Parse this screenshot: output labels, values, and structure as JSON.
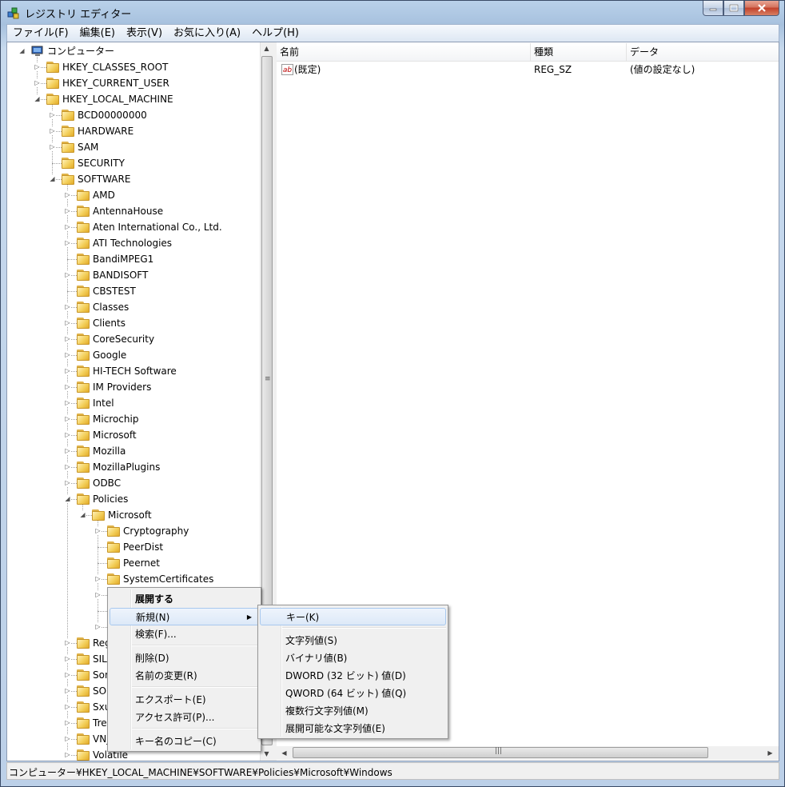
{
  "window": {
    "title": "レジストリ エディター"
  },
  "menubar": [
    "ファイル(F)",
    "編集(E)",
    "表示(V)",
    "お気に入り(A)",
    "ヘルプ(H)"
  ],
  "tree": [
    {
      "label": "コンピューター",
      "level": 0,
      "expander": "expanded",
      "icon": "computer-icon"
    },
    {
      "label": "HKEY_CLASSES_ROOT",
      "level": 1,
      "expander": "collapsed"
    },
    {
      "label": "HKEY_CURRENT_USER",
      "level": 1,
      "expander": "collapsed"
    },
    {
      "label": "HKEY_LOCAL_MACHINE",
      "level": 1,
      "expander": "expanded"
    },
    {
      "label": "BCD00000000",
      "level": 2,
      "expander": "collapsed"
    },
    {
      "label": "HARDWARE",
      "level": 2,
      "expander": "collapsed"
    },
    {
      "label": "SAM",
      "level": 2,
      "expander": "collapsed"
    },
    {
      "label": "SECURITY",
      "level": 2,
      "expander": "none"
    },
    {
      "label": "SOFTWARE",
      "level": 2,
      "expander": "expanded"
    },
    {
      "label": "AMD",
      "level": 3,
      "expander": "collapsed"
    },
    {
      "label": "AntennaHouse",
      "level": 3,
      "expander": "collapsed"
    },
    {
      "label": "Aten International Co., Ltd.",
      "level": 3,
      "expander": "collapsed"
    },
    {
      "label": "ATI Technologies",
      "level": 3,
      "expander": "collapsed"
    },
    {
      "label": "BandiMPEG1",
      "level": 3,
      "expander": "none"
    },
    {
      "label": "BANDISOFT",
      "level": 3,
      "expander": "collapsed"
    },
    {
      "label": "CBSTEST",
      "level": 3,
      "expander": "none"
    },
    {
      "label": "Classes",
      "level": 3,
      "expander": "collapsed"
    },
    {
      "label": "Clients",
      "level": 3,
      "expander": "collapsed"
    },
    {
      "label": "CoreSecurity",
      "level": 3,
      "expander": "collapsed"
    },
    {
      "label": "Google",
      "level": 3,
      "expander": "collapsed"
    },
    {
      "label": "HI-TECH Software",
      "level": 3,
      "expander": "collapsed"
    },
    {
      "label": "IM Providers",
      "level": 3,
      "expander": "collapsed"
    },
    {
      "label": "Intel",
      "level": 3,
      "expander": "collapsed"
    },
    {
      "label": "Microchip",
      "level": 3,
      "expander": "collapsed"
    },
    {
      "label": "Microsoft",
      "level": 3,
      "expander": "collapsed"
    },
    {
      "label": "Mozilla",
      "level": 3,
      "expander": "collapsed"
    },
    {
      "label": "MozillaPlugins",
      "level": 3,
      "expander": "collapsed"
    },
    {
      "label": "ODBC",
      "level": 3,
      "expander": "collapsed"
    },
    {
      "label": "Policies",
      "level": 3,
      "expander": "expanded"
    },
    {
      "label": "Microsoft",
      "level": 4,
      "expander": "expanded"
    },
    {
      "label": "Cryptography",
      "level": 5,
      "expander": "collapsed"
    },
    {
      "label": "PeerDist",
      "level": 5,
      "expander": "none"
    },
    {
      "label": "Peernet",
      "level": 5,
      "expander": "none"
    },
    {
      "label": "SystemCertificates",
      "level": 5,
      "expander": "collapsed"
    },
    {
      "label": "",
      "level": 5,
      "expander": "collapsed"
    },
    {
      "label": "",
      "level": 5,
      "expander": "none"
    },
    {
      "label": "",
      "level": 5,
      "expander": "collapsed"
    },
    {
      "label": "Regi",
      "level": 3,
      "expander": "collapsed"
    },
    {
      "label": "SILE",
      "level": 3,
      "expander": "collapsed"
    },
    {
      "label": "Soni",
      "level": 3,
      "expander": "collapsed"
    },
    {
      "label": "SOU",
      "level": 3,
      "expander": "collapsed"
    },
    {
      "label": "Sxup",
      "level": 3,
      "expander": "collapsed"
    },
    {
      "label": "Tren",
      "level": 3,
      "expander": "collapsed"
    },
    {
      "label": "VN_",
      "level": 3,
      "expander": "collapsed"
    },
    {
      "label": "Volatile",
      "level": 3,
      "expander": "collapsed"
    }
  ],
  "list": {
    "columns": [
      "名前",
      "種類",
      "データ"
    ],
    "rows": [
      {
        "name": "(既定)",
        "type": "REG_SZ",
        "data": "(値の設定なし)",
        "icon": "string-value-icon",
        "icon_text": "ab"
      }
    ]
  },
  "context_menu": [
    {
      "label": "展開する",
      "bold": true
    },
    {
      "label": "新規(N)",
      "submenu": true,
      "highlight": true
    },
    {
      "label": "検索(F)..."
    },
    {
      "sep": true
    },
    {
      "label": "削除(D)"
    },
    {
      "label": "名前の変更(R)"
    },
    {
      "sep": true
    },
    {
      "label": "エクスポート(E)"
    },
    {
      "label": "アクセス許可(P)..."
    },
    {
      "sep": true
    },
    {
      "label": "キー名のコピー(C)"
    }
  ],
  "submenu": [
    {
      "label": "キー(K)",
      "highlight": true
    },
    {
      "sep": true
    },
    {
      "label": "文字列値(S)"
    },
    {
      "label": "バイナリ値(B)"
    },
    {
      "label": "DWORD (32 ビット) 値(D)"
    },
    {
      "label": "QWORD (64 ビット) 値(Q)"
    },
    {
      "label": "複数行文字列値(M)"
    },
    {
      "label": "展開可能な文字列値(E)"
    }
  ],
  "statusbar": {
    "path": "コンピューター¥HKEY_LOCAL_MACHINE¥SOFTWARE¥Policies¥Microsoft¥Windows"
  },
  "colors": {
    "title_gradient_top": "#b9d1ea",
    "close_red": "#c2412a",
    "folder": "#f3cf5a",
    "highlight_border": "#a8c8ee"
  }
}
